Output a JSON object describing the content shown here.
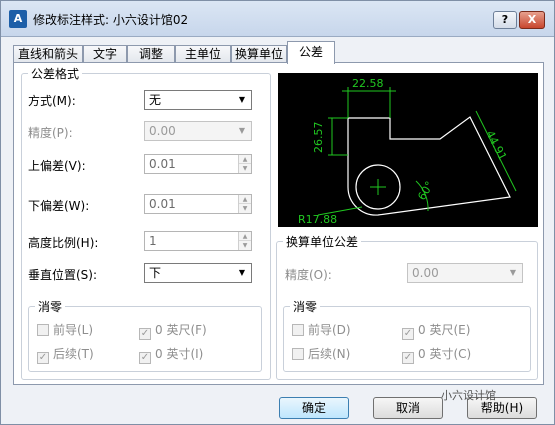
{
  "window": {
    "title": "修改标注样式: 小六设计馆02",
    "icon": "autocad-icon"
  },
  "titlebar": {
    "help_label": "?",
    "close_label": "X"
  },
  "tabs": [
    {
      "label": "直线和箭头"
    },
    {
      "label": "文字"
    },
    {
      "label": "调整"
    },
    {
      "label": "主单位"
    },
    {
      "label": "换算单位"
    },
    {
      "label": "公差"
    }
  ],
  "tolerance_format": {
    "group_title": "公差格式",
    "method_label": "方式(M):",
    "method_value": "无",
    "precision_label": "精度(P):",
    "precision_value": "0.00",
    "upper_label": "上偏差(V):",
    "upper_value": "0.01",
    "lower_label": "下偏差(W):",
    "lower_value": "0.01",
    "height_label": "高度比例(H):",
    "height_value": "1",
    "vertical_label": "垂直位置(S):",
    "vertical_value": "下"
  },
  "zero_suppression_left": {
    "title": "消零",
    "leading": "前导(L)",
    "trailing": "后续(T)",
    "feet": "0 英尺(F)",
    "inches": "0 英寸(I)"
  },
  "alt_unit_tolerance": {
    "group_title": "换算单位公差",
    "precision_label": "精度(O):",
    "precision_value": "0.00",
    "zero_title": "消零",
    "leading": "前导(D)",
    "trailing": "后续(N)",
    "feet": "0 英尺(E)",
    "inches": "0 英寸(C)"
  },
  "preview": {
    "dim_top": "22.58",
    "dim_left": "26.57",
    "dim_right": "44.91",
    "dim_angle": "60°",
    "dim_radius": "R17.88",
    "line_color": "#ffffff",
    "dim_color": "#21c821"
  },
  "buttons": {
    "ok": "确定",
    "cancel": "取消",
    "help": "帮助(H)"
  },
  "watermark": "小六设计馆"
}
